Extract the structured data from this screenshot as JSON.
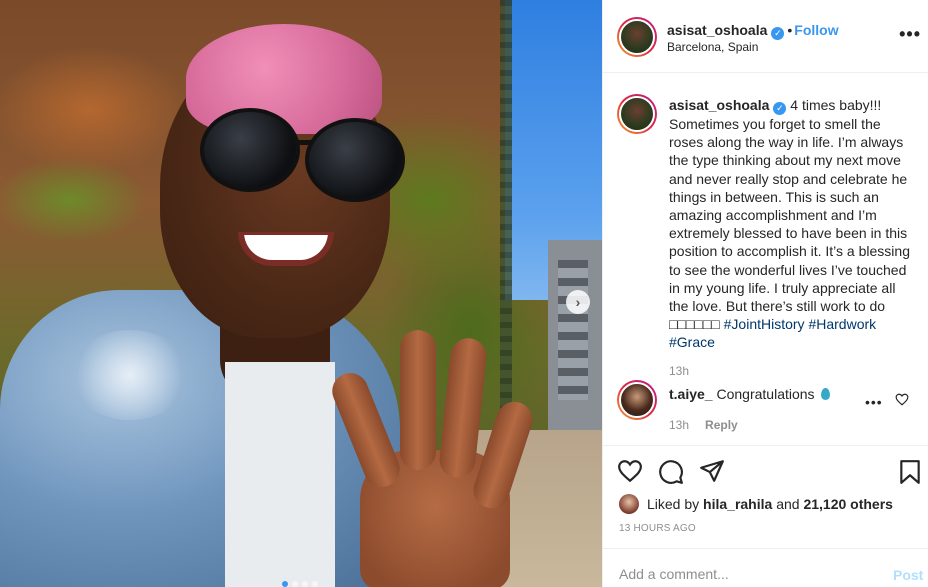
{
  "header": {
    "username": "asisat_oshoala",
    "verified_badge": "✓",
    "bullet": "•",
    "follow_label": "Follow",
    "location": "Barcelona, Spain",
    "more_label": "•••"
  },
  "caption": {
    "username": "asisat_oshoala",
    "text_before_tags": "4 times baby!!! Sometimes you forget to smell the roses along the way in life. I’m always the type thinking about my next move and never really stop and celebrate he things in between. This is such an amazing accomplishment and I’m extremely blessed to have been in this position to accomplish it. It’s a blessing to see the wonderful lives I’ve touched in my young life. I truly appreciate all the love. But there’s still work to do □□□□□□",
    "tags": [
      "#JointHistory",
      "#Hardwork",
      "#Grace"
    ],
    "time": "13h"
  },
  "comment": {
    "username": "t.aiye_",
    "text": "Congratulations",
    "emoji": "blue-heart-emoji",
    "time": "13h",
    "reply_label": "Reply",
    "more_label": "•••"
  },
  "actions": {
    "icons": [
      "heart-icon",
      "comment-icon",
      "share-icon",
      "bookmark-icon"
    ]
  },
  "likes": {
    "prefix": "Liked by",
    "user": "hila_rahila",
    "middle": "and",
    "count": "21,120 others"
  },
  "post_time": "13 HOURS AGO",
  "comment_box": {
    "placeholder": "Add a comment...",
    "post_label": "Post"
  },
  "carousel": {
    "next_arrow": "›",
    "slide_count": 4,
    "active_index": 0
  },
  "colors": {
    "accent": "#3897f0",
    "hashtag": "#00376b",
    "muted": "#8e8e8e",
    "post_disabled": "#b2dffc"
  }
}
